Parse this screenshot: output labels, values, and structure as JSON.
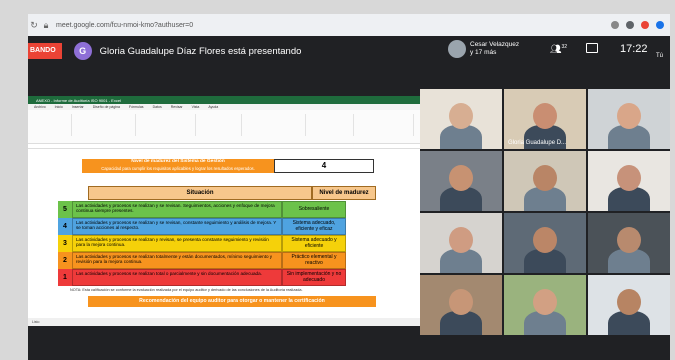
{
  "browser": {
    "url": "meet.google.com/fcu-nmoi-kmo?authuser=0",
    "back_icon": "arrow-left-icon",
    "reload_icon": "reload-icon"
  },
  "meet": {
    "recording_label": "BANDO",
    "presenter_initial": "G",
    "presenting_text": "Gloria Guadalupe Díaz Flores está presentando",
    "speaker_name": "Cesar Velazquez",
    "speaker_sub": "y 17 más",
    "people_count": "32",
    "clock": "17:22",
    "more_label": "Tú",
    "colors": {
      "record": "#ea4335",
      "avatar": "#8e6fd6",
      "background": "#202124"
    }
  },
  "excel": {
    "title": "ANEXO - Informe de Auditoría ISO 9001 - Excel",
    "tabs": [
      "Archivo",
      "Inicio",
      "Insertar",
      "Diseño de página",
      "Fórmulas",
      "Datos",
      "Revisar",
      "Vista",
      "Ayuda"
    ],
    "status_left": "Listo"
  },
  "sheet": {
    "madurez_title": "Nivel de madurez del Sistema de Gestión",
    "madurez_subtitle": "Capacidad para cumplir los requisitos aplicables y lograr los resultados esperados.",
    "madurez_value": "4",
    "header_situacion": "Situación",
    "header_nivel": "Nivel de madurez",
    "rows": [
      {
        "level": "5",
        "situacion": "Las actividades y procesos se realizan y se revisan. Seguimientos, acciones y enfoque de mejora continua siempre presentes.",
        "nivel": "Sobresaliente",
        "color": "#6cc24a"
      },
      {
        "level": "4",
        "situacion": "Las actividades y procesos se realizan y se revisan, constante seguimiento y análisis de mejora. Y se toman acciones al respecto.",
        "nivel": "Sistema adecuado, eficiente y eficaz",
        "color": "#4fa3e0"
      },
      {
        "level": "3",
        "situacion": "Las actividades y procesos se realizan y revisan, se presenta constante seguimiento y revisión para la mejora continua.",
        "nivel": "Sistema adecuado y eficiente",
        "color": "#f5d10a"
      },
      {
        "level": "2",
        "situacion": "Las actividades y procesos se realizan totalmente y están documentados, mínimo seguimiento y revisión para la mejora continua.",
        "nivel": "Práctico elemental y reactivo",
        "color": "#f7931e"
      },
      {
        "level": "1",
        "situacion": "Las actividades y procesos se realizan total o parcialmente y sin documentación adecuada.",
        "nivel": "Sin implementación y no adecuado",
        "color": "#ee3a3a"
      }
    ],
    "nota": "NOTA: Esta calificación se conforme la evaluación realizada por el equipo auditor y derivado de las conclusiones de la Auditoría realizada.",
    "recomendacion": "Recomendación del equipo auditor para otorgar o mantener la certificación"
  },
  "participants": [
    {
      "name": "",
      "bg": "#e8e2d8",
      "face": "#d7ae92"
    },
    {
      "name": "Gloria Guadalupe D...",
      "bg": "#d8cbb5",
      "face": "#c98e72"
    },
    {
      "name": "",
      "bg": "#cfd3d6",
      "face": "#d9a689"
    },
    {
      "name": "",
      "bg": "#7a8088",
      "face": "#c79272"
    },
    {
      "name": "",
      "bg": "#cfc7b7",
      "face": "#b98566"
    },
    {
      "name": "",
      "bg": "#e9e6e1",
      "face": "#c7927a"
    },
    {
      "name": "",
      "bg": "#d6d3cf",
      "face": "#cf9c82"
    },
    {
      "name": "",
      "bg": "#5e6a76",
      "face": "#bb8667"
    },
    {
      "name": "",
      "bg": "#4b5258",
      "face": "#b88a6e"
    },
    {
      "name": "",
      "bg": "#a38970",
      "face": "#c79677"
    },
    {
      "name": "",
      "bg": "#9ab37e",
      "face": "#d2a083"
    },
    {
      "name": "",
      "bg": "#dde2e6",
      "face": "#b78463"
    }
  ]
}
